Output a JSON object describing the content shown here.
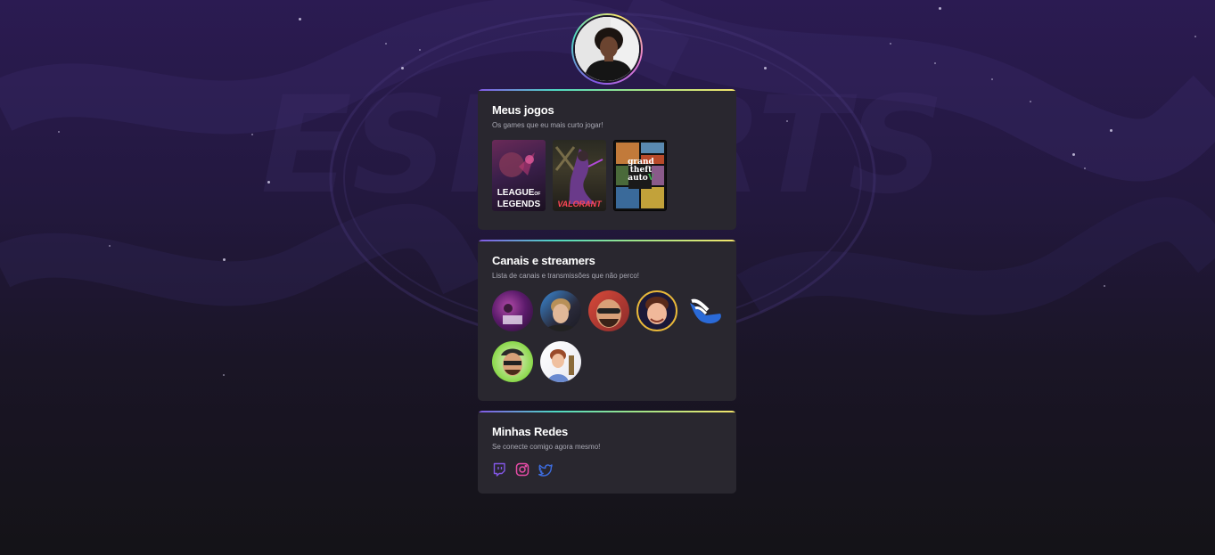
{
  "profile": {
    "avatar_icon": "profile-photo"
  },
  "games_card": {
    "title": "Meus jogos",
    "subtitle": "Os games que eu mais curto jogar!",
    "games": [
      {
        "name": "League of Legends",
        "logo_line1": "LEAGUE",
        "logo_line2": "LEGENDS",
        "logo_of": "OF"
      },
      {
        "name": "Valorant",
        "logo": "VALORANT"
      },
      {
        "name": "Grand Theft Auto V",
        "logo_line1": "grand",
        "logo_line2": "theft",
        "logo_line3": "auto",
        "logo_v": "V"
      }
    ]
  },
  "streamers_card": {
    "title": "Canais e streamers",
    "subtitle": "Lista de canais e transmissões que não perco!",
    "streamers": [
      "streamer-1",
      "streamer-2",
      "streamer-3",
      "streamer-4",
      "streamer-5",
      "streamer-6",
      "streamer-7"
    ]
  },
  "socials_card": {
    "title": "Minhas Redes",
    "subtitle": "Se conecte comigo agora mesmo!",
    "links": [
      {
        "icon": "twitch-icon",
        "color": "#8257e5"
      },
      {
        "icon": "instagram-icon",
        "color": "#e84ca8"
      },
      {
        "icon": "twitter-icon",
        "color": "#3d6de0"
      }
    ]
  },
  "colors": {
    "card_bg": "#29272f",
    "accent": "#8257e5"
  }
}
